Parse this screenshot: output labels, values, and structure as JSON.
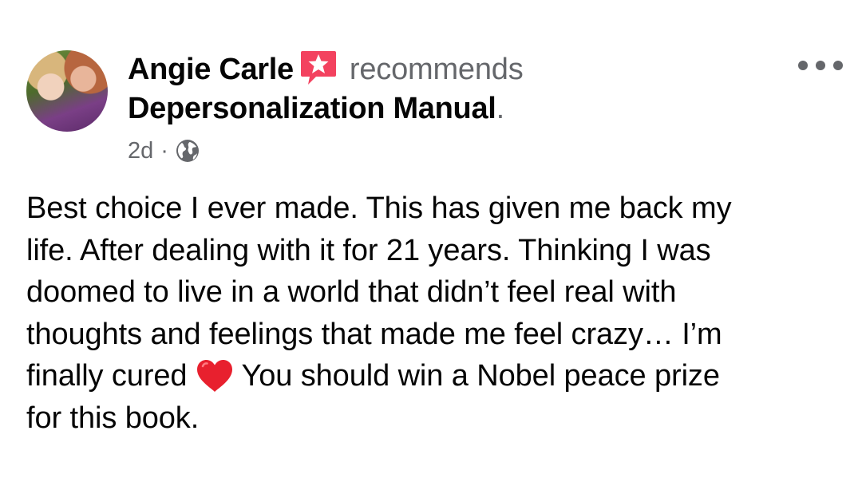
{
  "post": {
    "author_name": "Angie Carle",
    "action_text": "recommends",
    "page_name": "Depersonalization Manual",
    "page_name_suffix": ".",
    "timestamp": "2d",
    "separator": "·",
    "privacy_icon": "globe-icon",
    "badge_icon": "recommendation-star-icon",
    "menu_icon": "more-options-icon",
    "body_lines": [
      "Best choice I ever made. This has given me back my",
      "life. After dealing with it for 21 years. Thinking I was",
      "doomed to live in a world that didn’t feel real with",
      "thoughts and feelings that made me feel crazy… I’m",
      "finally cured",
      "You should win a Nobel peace prize",
      "for this book."
    ],
    "inline_emoji": "red-heart-icon"
  },
  "colors": {
    "primary_text": "#050505",
    "secondary_text": "#65676b",
    "badge_pink": "#f3425f",
    "heart_red": "#e8202e",
    "background": "#ffffff"
  }
}
